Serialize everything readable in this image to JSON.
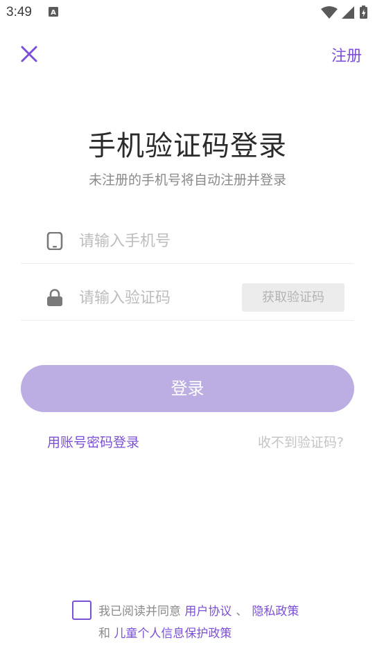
{
  "status_bar": {
    "time": "3:49",
    "notification_icon": "text-a-icon",
    "wifi_icon": "wifi-icon",
    "signal_icon": "cell-signal-icon",
    "battery_icon": "battery-charging-icon"
  },
  "nav": {
    "close_icon": "close-icon",
    "register_label": "注册"
  },
  "header": {
    "title": "手机验证码登录",
    "subtitle": "未注册的手机号将自动注册并登录"
  },
  "form": {
    "phone": {
      "icon": "phone-icon",
      "placeholder": "请输入手机号",
      "value": ""
    },
    "code": {
      "icon": "lock-icon",
      "placeholder": "请输入验证码",
      "value": "",
      "get_code_label": "获取验证码"
    }
  },
  "actions": {
    "login_label": "登录",
    "password_login_label": "用账号密码登录",
    "no_code_label": "收不到验证码?"
  },
  "agreement": {
    "checked": false,
    "prefix": "我已阅读并同意",
    "user_agreement": "用户协议",
    "separator": "、",
    "privacy_policy": "隐私政策",
    "and": "和",
    "child_policy": "儿童个人信息保护政策"
  },
  "colors": {
    "accent": "#7b4fd6",
    "login_button_disabled": "#bcaee3",
    "get_code_button_bg": "#ececec"
  }
}
